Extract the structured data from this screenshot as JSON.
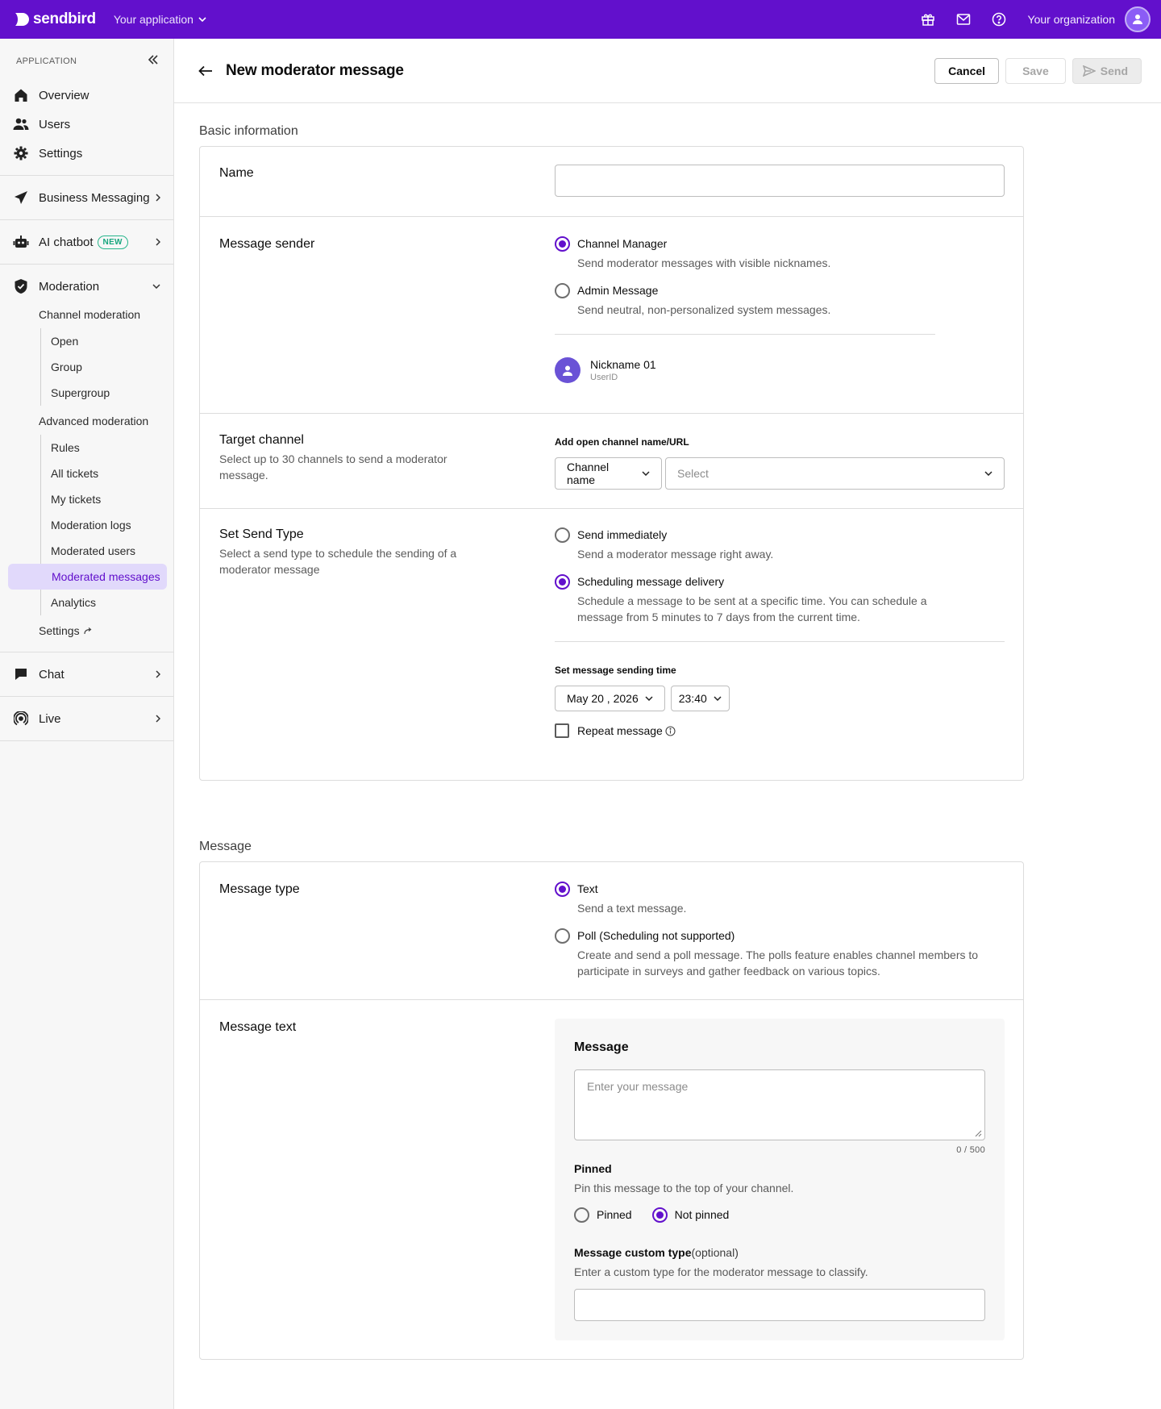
{
  "topbar": {
    "logo": "sendbird",
    "app_name": "Your application",
    "org_name": "Your organization",
    "icons": [
      "gift-icon",
      "mail-icon",
      "help-icon"
    ]
  },
  "sidebar": {
    "caption": "APPLICATION",
    "top_items": [
      {
        "label": "Overview",
        "icon": "home-icon"
      },
      {
        "label": "Users",
        "icon": "users-icon"
      },
      {
        "label": "Settings",
        "icon": "gear-icon"
      }
    ],
    "business_messaging": "Business Messaging",
    "ai_chatbot": "AI chatbot",
    "new_badge": "NEW",
    "moderation": "Moderation",
    "channel_moderation": "Channel moderation",
    "channel_items": [
      "Open",
      "Group",
      "Supergroup"
    ],
    "advanced_moderation": "Advanced moderation",
    "advanced_items": [
      "Rules",
      "All tickets",
      "My tickets",
      "Moderation logs",
      "Moderated users",
      "Moderated messages",
      "Analytics"
    ],
    "mod_settings": "Settings",
    "chat": "Chat",
    "live": "Live"
  },
  "header": {
    "title": "New moderator message",
    "cancel": "Cancel",
    "save": "Save",
    "send": "Send"
  },
  "basic": {
    "section_label": "Basic information",
    "name_label": "Name",
    "name_value": "",
    "sender_label": "Message sender",
    "sender_options": [
      {
        "label": "Channel Manager",
        "desc": "Send moderator messages with visible nicknames.",
        "selected": true
      },
      {
        "label": "Admin Message",
        "desc": "Send neutral, non-personalized system messages.",
        "selected": false
      }
    ],
    "nickname": "Nickname 01",
    "user_id": "UserID",
    "target_label": "Target channel",
    "target_desc": "Select up to 30 channels to send a moderator message.",
    "target_field_label": "Add open channel name/URL",
    "target_type": "Channel name",
    "target_placeholder": "Select",
    "send_type_label": "Set Send Type",
    "send_type_desc": "Select a send type to schedule the sending of a moderator message",
    "send_options": [
      {
        "label": "Send immediately",
        "desc": "Send a moderator message right away.",
        "selected": false
      },
      {
        "label": "Scheduling message delivery",
        "desc": "Schedule a message to be sent at a specific time. You can schedule a message from 5 minutes to 7 days from the current time.",
        "selected": true
      }
    ],
    "time_label": "Set message sending time",
    "date_value": "May 20 , 2026",
    "time_value": "23:40",
    "repeat_label": "Repeat message"
  },
  "message": {
    "section_label": "Message",
    "type_label": "Message type",
    "type_options": [
      {
        "label": "Text",
        "desc": "Send a text message.",
        "selected": true
      },
      {
        "label": "Poll (Scheduling not supported)",
        "desc": "Create and send a poll message. The polls feature enables channel members to participate in surveys and gather feedback on various topics.",
        "selected": false
      }
    ],
    "text_label": "Message text",
    "box_title": "Message",
    "placeholder": "Enter your message",
    "counter": "0 / 500",
    "pinned_title": "Pinned",
    "pinned_desc": "Pin this message to the top of your channel.",
    "pinned_opt": "Pinned",
    "not_pinned_opt": "Not pinned",
    "custom_type_title": "Message custom type",
    "custom_type_optional": "(optional)",
    "custom_type_desc": "Enter a custom type for the moderator message to classify."
  },
  "colors": {
    "brand": "#6210cc",
    "active_bg": "#e1d9fb",
    "new_badge": "#17a67e"
  }
}
